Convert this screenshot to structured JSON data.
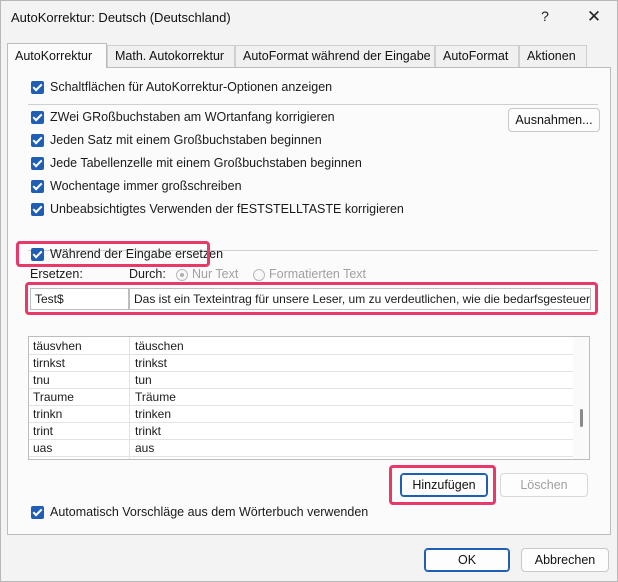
{
  "window": {
    "title": "AutoKorrektur: Deutsch (Deutschland)",
    "help_glyph": "?",
    "close_glyph": "✕"
  },
  "tabs": [
    {
      "label": "AutoKorrektur",
      "active": true
    },
    {
      "label": "Math. Autokorrektur",
      "active": false
    },
    {
      "label": "AutoFormat während der Eingabe",
      "active": false
    },
    {
      "label": "AutoFormat",
      "active": false
    },
    {
      "label": "Aktionen",
      "active": false
    }
  ],
  "options": {
    "show_buttons": "Schaltflächen für AutoKorrektur-Optionen anzeigen",
    "two_caps": "ZWei GRoßbuchstaben am WOrtanfang korrigieren",
    "sentence_cap": "Jeden Satz mit einem Großbuchstaben beginnen",
    "table_cell_cap": "Jede Tabellenzelle mit einem Großbuchstaben beginnen",
    "weekdays": "Wochentage immer großschreiben",
    "caps_lock": "Unbeabsichtigtes Verwenden der fESTSTELLTASTE korrigieren",
    "replace_while_typing": "Während der Eingabe ersetzen",
    "dictionary_suggestions": "Automatisch Vorschläge aus dem Wörterbuch verwenden"
  },
  "buttons": {
    "exceptions": "Ausnahmen...",
    "add": "Hinzufügen",
    "delete": "Löschen",
    "ok": "OK",
    "cancel": "Abbrechen"
  },
  "replace": {
    "replace_label": "Ersetzen:",
    "with_label": "Durch:",
    "plain_text": "Nur Text",
    "formatted_text": "Formatierten Text",
    "replace_value": "Test$",
    "with_value": "Das ist ein Texteintrag für unsere Leser, um zu verdeutlichen, wie die bedarfsgesteuerte A"
  },
  "entries": [
    {
      "from": "täusvhen",
      "to": "täuschen"
    },
    {
      "from": "tirnkst",
      "to": "trinkst"
    },
    {
      "from": "tnu",
      "to": "tun"
    },
    {
      "from": "Traume",
      "to": "Träume"
    },
    {
      "from": "trinkn",
      "to": "trinken"
    },
    {
      "from": "trint",
      "to": "trinkt"
    },
    {
      "from": "uas",
      "to": "aus"
    }
  ],
  "colors": {
    "accent": "#1f5fb3",
    "highlight": "#e8396a"
  }
}
